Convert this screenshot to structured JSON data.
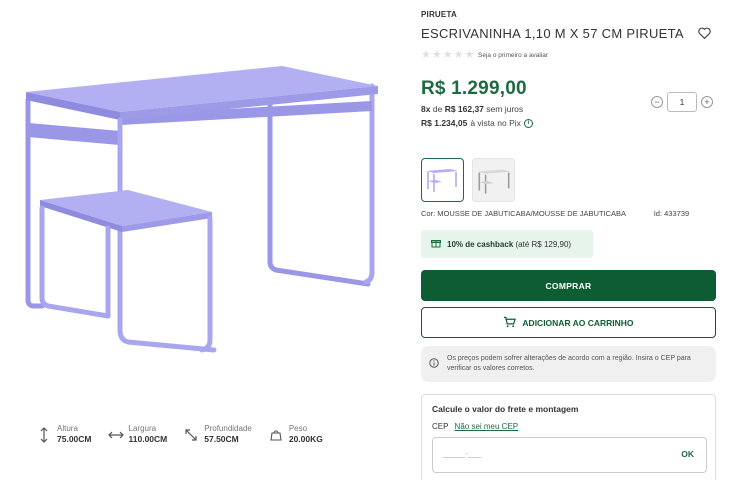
{
  "product": {
    "brand": "PIRUETA",
    "title": "ESCRIVANINHA 1,10 M X 57 CM PIRUETA",
    "review_link": "Seja o primeiro a avaliar",
    "price": "R$ 1.299,00",
    "installments_prefix": "8x",
    "installments_mid": "de",
    "installments_value": "R$ 162,37",
    "installments_suffix": "sem juros",
    "pix_value": "R$ 1.234,05",
    "pix_suffix": "à vista no Pix",
    "quantity": "1",
    "color_label": "Cor: MOUSSE DE JABUTICABA/MOUSSE DE JABUTICABA",
    "id_label": "Id: 433739",
    "rating_stars": 0
  },
  "cashback": {
    "bold": "10% de cashback",
    "rest": "(até R$ 129,90)"
  },
  "buttons": {
    "buy": "COMPRAR",
    "add_cart": "ADICIONAR AO CARRINHO"
  },
  "notice": {
    "text": "Os preços podem sofrer alterações de acordo com a região. Insira o CEP para verificar os valores corretos."
  },
  "freight": {
    "title": "Calcule o valor do frete e montagem",
    "cep_label": "CEP",
    "cep_link": "Não sei meu CEP",
    "placeholder": "_____-___",
    "ok": "OK"
  },
  "specs": [
    {
      "label": "Altura",
      "value": "75.00CM",
      "icon": "height-icon"
    },
    {
      "label": "Largura",
      "value": "110.00CM",
      "icon": "width-icon"
    },
    {
      "label": "Profundidade",
      "value": "57.50CM",
      "icon": "depth-icon"
    },
    {
      "label": "Peso",
      "value": "20.00KG",
      "icon": "weight-icon"
    }
  ],
  "colors": {
    "accent": "#1d6b3f",
    "button": "#0e5c34",
    "desk": "#a8a6ef"
  }
}
